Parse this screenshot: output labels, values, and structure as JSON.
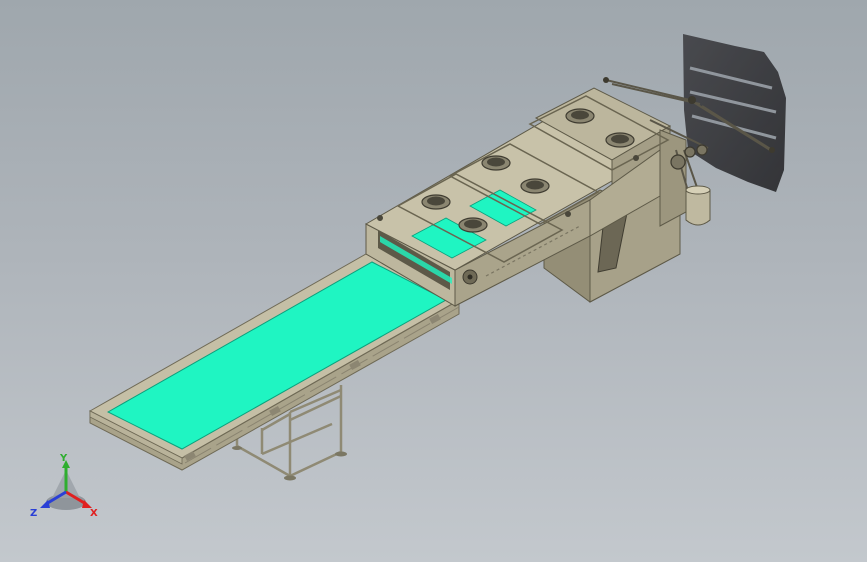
{
  "triad": {
    "x_label": "X",
    "y_label": "Y",
    "z_label": "Z",
    "x_color": "#e02020",
    "y_color": "#2fae2f",
    "z_color": "#2a3fd6"
  },
  "colors": {
    "background_top": "#9fa7ad",
    "background_bottom": "#c3c8cd",
    "frame": "#c7c1a8",
    "frame_dark": "#9e987f",
    "frame_side": "#b3ad93",
    "belt": "#1ff5c2",
    "shadow": "#2c2c30"
  }
}
